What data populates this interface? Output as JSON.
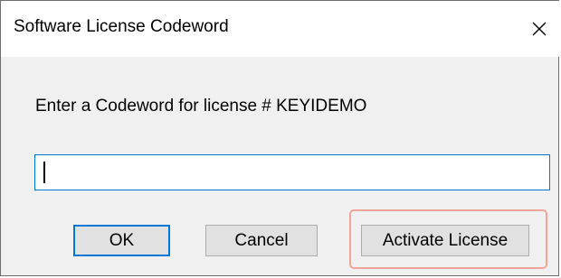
{
  "window": {
    "title": "Software License Codeword",
    "close_icon": "close-icon"
  },
  "content": {
    "prompt": "Enter a Codeword for license # KEYIDEMO",
    "codeword": {
      "value": "",
      "placeholder": ""
    }
  },
  "buttons": {
    "ok_label": "OK",
    "cancel_label": "Cancel",
    "activate_label": "Activate License"
  },
  "colors": {
    "focus_accent": "#0078d7",
    "button_face": "#e1e1e1",
    "dialog_background": "#f0f0f0",
    "highlight_outline": "#f4a497"
  }
}
